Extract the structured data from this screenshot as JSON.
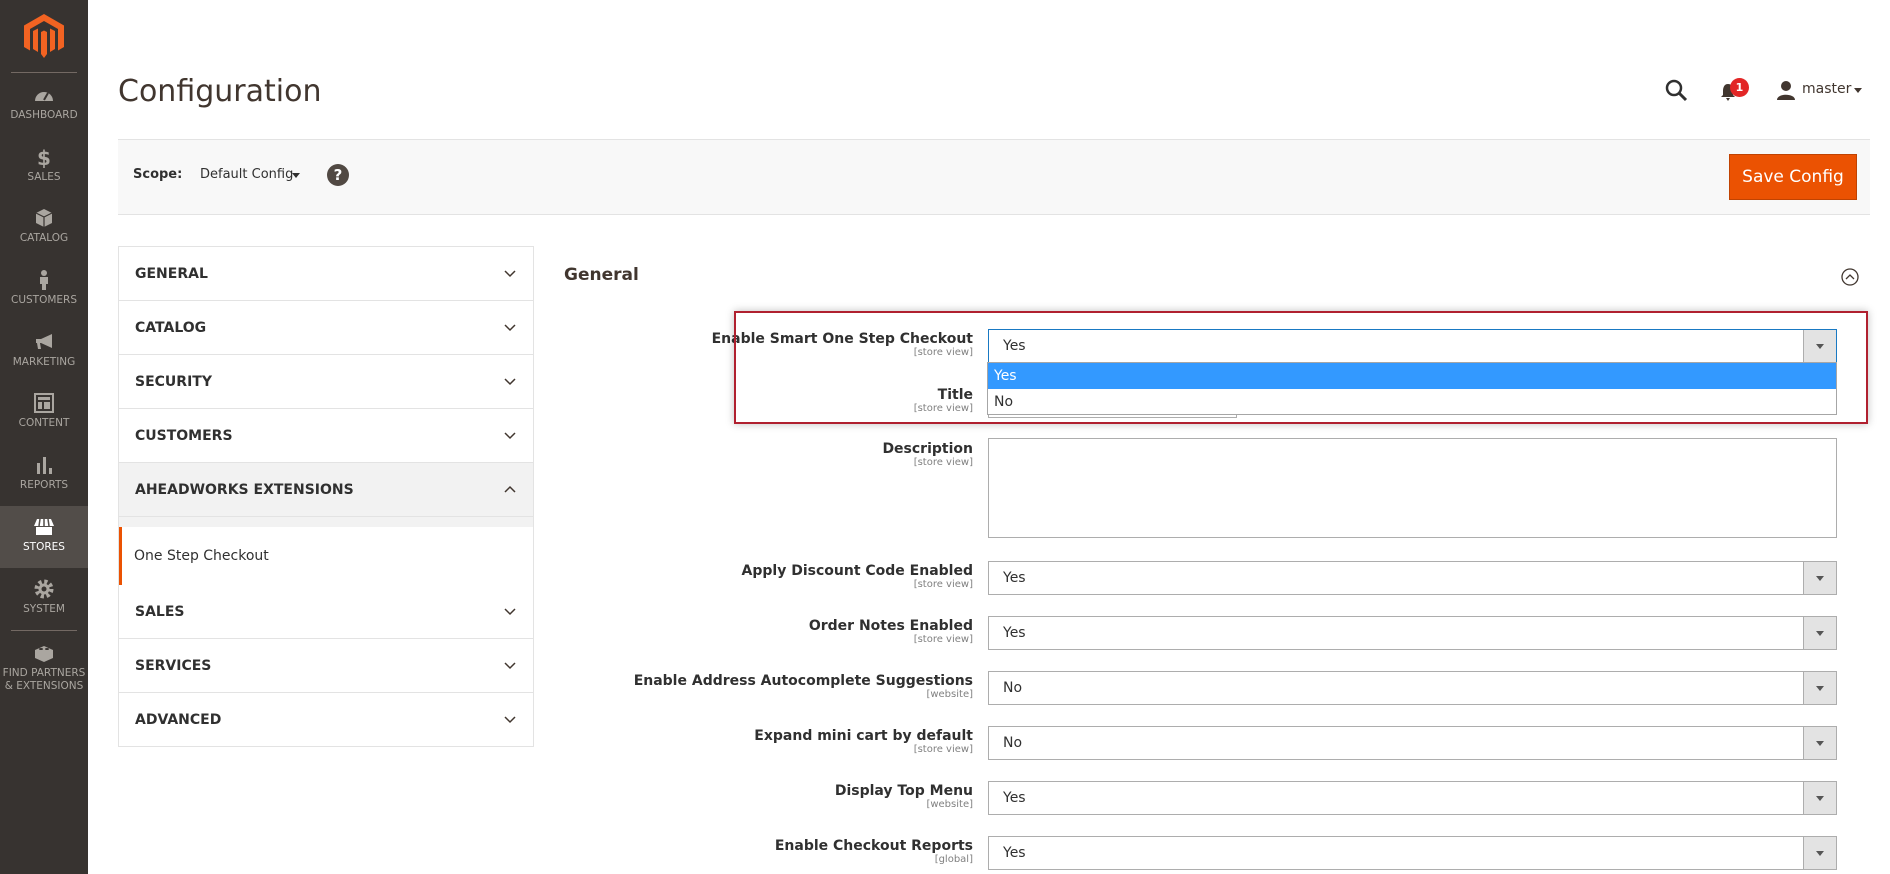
{
  "sidebar": {
    "items": [
      {
        "label": "DASHBOARD",
        "icon": "dashboard-icon"
      },
      {
        "label": "SALES",
        "icon": "dollar-icon"
      },
      {
        "label": "CATALOG",
        "icon": "box-icon"
      },
      {
        "label": "CUSTOMERS",
        "icon": "person-icon"
      },
      {
        "label": "MARKETING",
        "icon": "megaphone-icon"
      },
      {
        "label": "CONTENT",
        "icon": "layout-icon"
      },
      {
        "label": "REPORTS",
        "icon": "bar-chart-icon"
      },
      {
        "label": "STORES",
        "icon": "store-icon",
        "active": true
      },
      {
        "label": "SYSTEM",
        "icon": "gear-icon"
      },
      {
        "label": "FIND PARTNERS",
        "label2": "& EXTENSIONS",
        "icon": "lego-icon"
      }
    ]
  },
  "header": {
    "title": "Configuration",
    "notifications": "1",
    "user": "master"
  },
  "scope": {
    "label": "Scope:",
    "value": "Default Config",
    "save": "Save Config"
  },
  "tabs": [
    "GENERAL",
    "CATALOG",
    "SECURITY",
    "CUSTOMERS",
    "AHEADWORKS EXTENSIONS",
    "One Step Checkout",
    "SALES",
    "SERVICES",
    "ADVANCED"
  ],
  "section": "General",
  "fields": [
    {
      "label": "Enable Smart One Step Checkout",
      "scope": "[store view]",
      "value": "Yes"
    },
    {
      "label": "Title",
      "scope": "[store view]",
      "value": ""
    },
    {
      "label": "Description",
      "scope": "[store view]",
      "value": ""
    },
    {
      "label": "Apply Discount Code Enabled",
      "scope": "[store view]",
      "value": "Yes"
    },
    {
      "label": "Order Notes Enabled",
      "scope": "[store view]",
      "value": "Yes"
    },
    {
      "label": "Enable Address Autocomplete Suggestions",
      "scope": "[website]",
      "value": "No"
    },
    {
      "label": "Expand mini cart by default",
      "scope": "[store view]",
      "value": "No"
    },
    {
      "label": "Display Top Menu",
      "scope": "[website]",
      "value": "Yes"
    },
    {
      "label": "Enable Checkout Reports",
      "scope": "[global]",
      "value": "Yes"
    }
  ],
  "dropdown_options": [
    "Yes",
    "No"
  ],
  "colors": {
    "accent": "#eb5202",
    "sidebar": "#373330",
    "highlight": "#3399ff",
    "annotation": "#b0202f"
  }
}
